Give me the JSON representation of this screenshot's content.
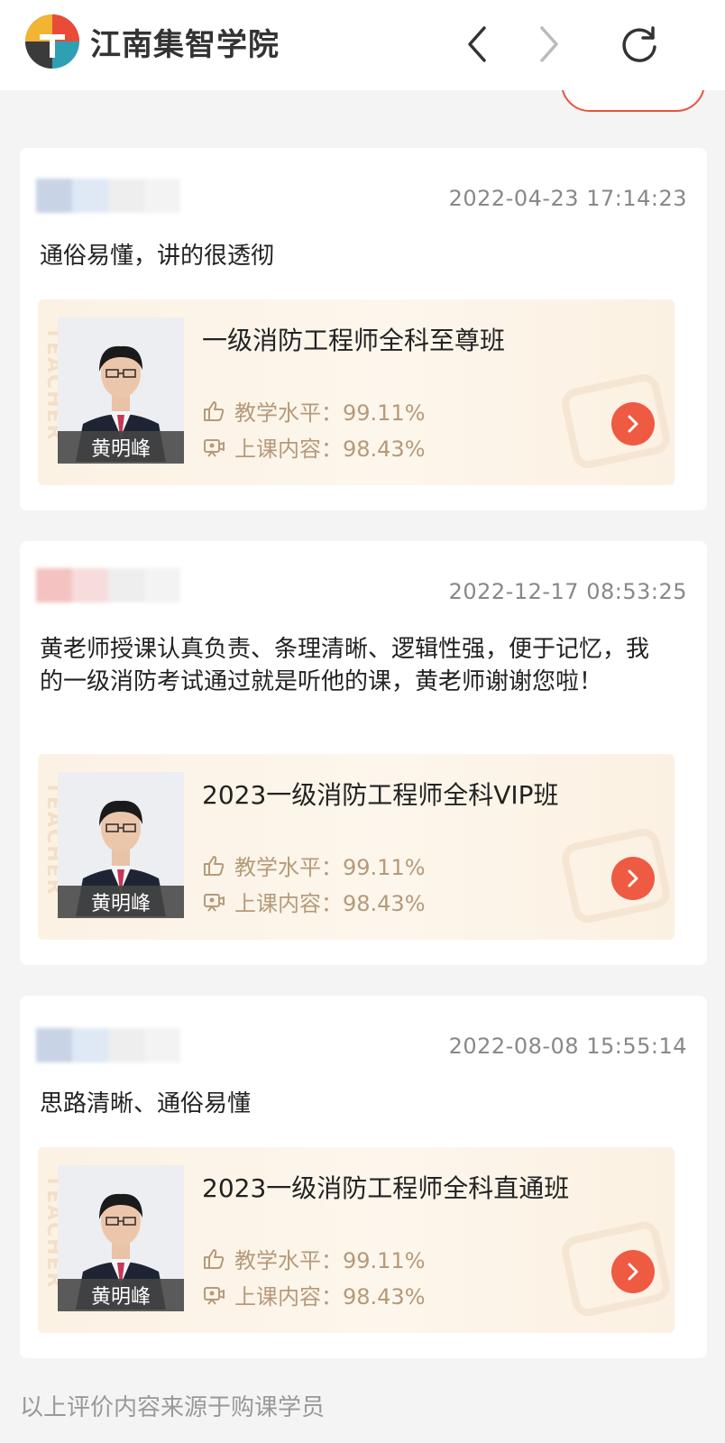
{
  "header": {
    "brand_name": "江南集智学院",
    "back_icon": "chevron-left-icon",
    "forward_icon": "chevron-right-icon",
    "refresh_icon": "refresh-icon"
  },
  "colors": {
    "accent": "#ef5a42",
    "metric_text": "#b59a7a",
    "card_bg": "#ffffff",
    "page_bg": "#f4f4f4"
  },
  "reviews": [
    {
      "time": "2022-04-23 17:14:23",
      "text": "通俗易懂，讲的很透彻",
      "course": {
        "teacher": "黄明峰",
        "title": "一级消防工程师全科至尊班",
        "teaching_level": "教学水平：99.11%",
        "content_level": "上课内容：98.43%"
      }
    },
    {
      "time": "2022-12-17 08:53:25",
      "text": "黄老师授课认真负责、条理清晰、逻辑性强，便于记忆，我的一级消防考试通过就是听他的课，黄老师谢谢您啦！",
      "course": {
        "teacher": "黄明峰",
        "title": "2023一级消防工程师全科VIP班",
        "teaching_level": "教学水平：99.11%",
        "content_level": "上课内容：98.43%"
      }
    },
    {
      "time": "2022-08-08 15:55:14",
      "text": "思路清晰、通俗易懂",
      "course": {
        "teacher": "黄明峰",
        "title": "2023一级消防工程师全科直通班",
        "teaching_level": "教学水平：99.11%",
        "content_level": "上课内容：98.43%"
      }
    }
  ],
  "footer_note": "以上评价内容来源于购课学员"
}
